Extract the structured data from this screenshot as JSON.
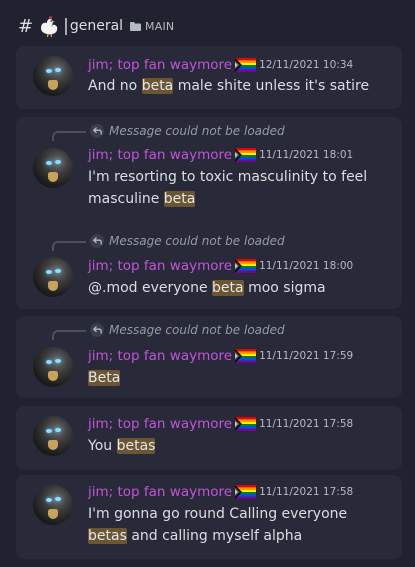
{
  "header": {
    "hash": "#",
    "separator": "|",
    "channel": "general",
    "category": "MAIN"
  },
  "messages": [
    {
      "author": "jim;  top fan waymore",
      "timestamp": "12/11/2021 10:34",
      "reply_text": "",
      "content": [
        {
          "text": "And no ",
          "hl": false
        },
        {
          "text": "beta",
          "hl": true
        },
        {
          "text": " male shite unless it's satire",
          "hl": false
        }
      ]
    },
    {
      "author": "jim;  top fan waymore",
      "timestamp": "11/11/2021 18:01",
      "reply_text": "Message could not be loaded",
      "content": [
        {
          "text": "I'm resorting to toxic masculinity to feel masculine ",
          "hl": false
        },
        {
          "text": "beta",
          "hl": true
        }
      ]
    },
    {
      "author": "jim;  top fan waymore",
      "timestamp": "11/11/2021 18:00",
      "reply_text": "Message could not be loaded",
      "content": [
        {
          "text": "@.mod everyone ",
          "hl": false
        },
        {
          "text": "beta",
          "hl": true
        },
        {
          "text": " moo sigma",
          "hl": false
        }
      ]
    },
    {
      "author": "jim;  top fan waymore",
      "timestamp": "11/11/2021 17:59",
      "reply_text": "Message could not be loaded",
      "content": [
        {
          "text": "Beta",
          "hl": true
        }
      ]
    },
    {
      "author": "jim;  top fan waymore",
      "timestamp": "11/11/2021 17:58",
      "reply_text": "",
      "content": [
        {
          "text": "You ",
          "hl": false
        },
        {
          "text": "betas",
          "hl": true
        }
      ]
    },
    {
      "author": "jim;  top fan waymore",
      "timestamp": "11/11/2021 17:58",
      "reply_text": "",
      "content": [
        {
          "text": "I'm gonna go round Calling everyone ",
          "hl": false
        },
        {
          "text": "betas",
          "hl": true
        },
        {
          "text": " and calling myself alpha",
          "hl": false
        }
      ]
    }
  ],
  "colors": {
    "background": "#202230",
    "card": "#282a3a",
    "author": "#c254d8",
    "highlight": "#6b5634"
  },
  "icons": {
    "channel_emoji": "chicken-icon",
    "category": "folder-icon",
    "reply": "reply-arrow-icon",
    "author_badge": "progress-pride-flag-icon"
  }
}
